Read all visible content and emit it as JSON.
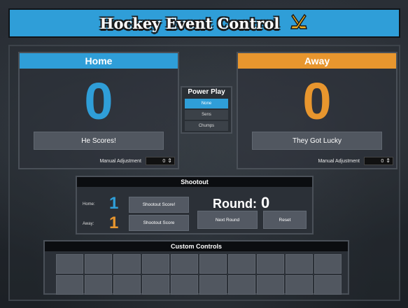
{
  "header": {
    "title": "Hockey Event Control",
    "icon": "hockey-sticks-icon"
  },
  "home": {
    "label": "Home",
    "score": "0",
    "button_label": "He Scores!",
    "manual_label": "Manual Adjustment",
    "manual_value": "0",
    "color": "#2f9ed8"
  },
  "away": {
    "label": "Away",
    "score": "0",
    "button_label": "They Got Lucky",
    "manual_label": "Manual Adjustment",
    "manual_value": "0",
    "color": "#e8962e"
  },
  "power_play": {
    "title": "Power Play",
    "options": [
      "None",
      "Sens",
      "Chumps"
    ],
    "selected": "None"
  },
  "shootout": {
    "title": "Shootout",
    "home_label": "Home:",
    "away_label": "Away:",
    "home_score": "1",
    "away_score": "1",
    "home_button": "Shootout Score!",
    "away_button": "Shootout Score",
    "round_label": "Round:",
    "round_value": "0",
    "next_round_button": "Next Round",
    "reset_button": "Reset"
  },
  "custom_controls": {
    "title": "Custom Controls"
  }
}
